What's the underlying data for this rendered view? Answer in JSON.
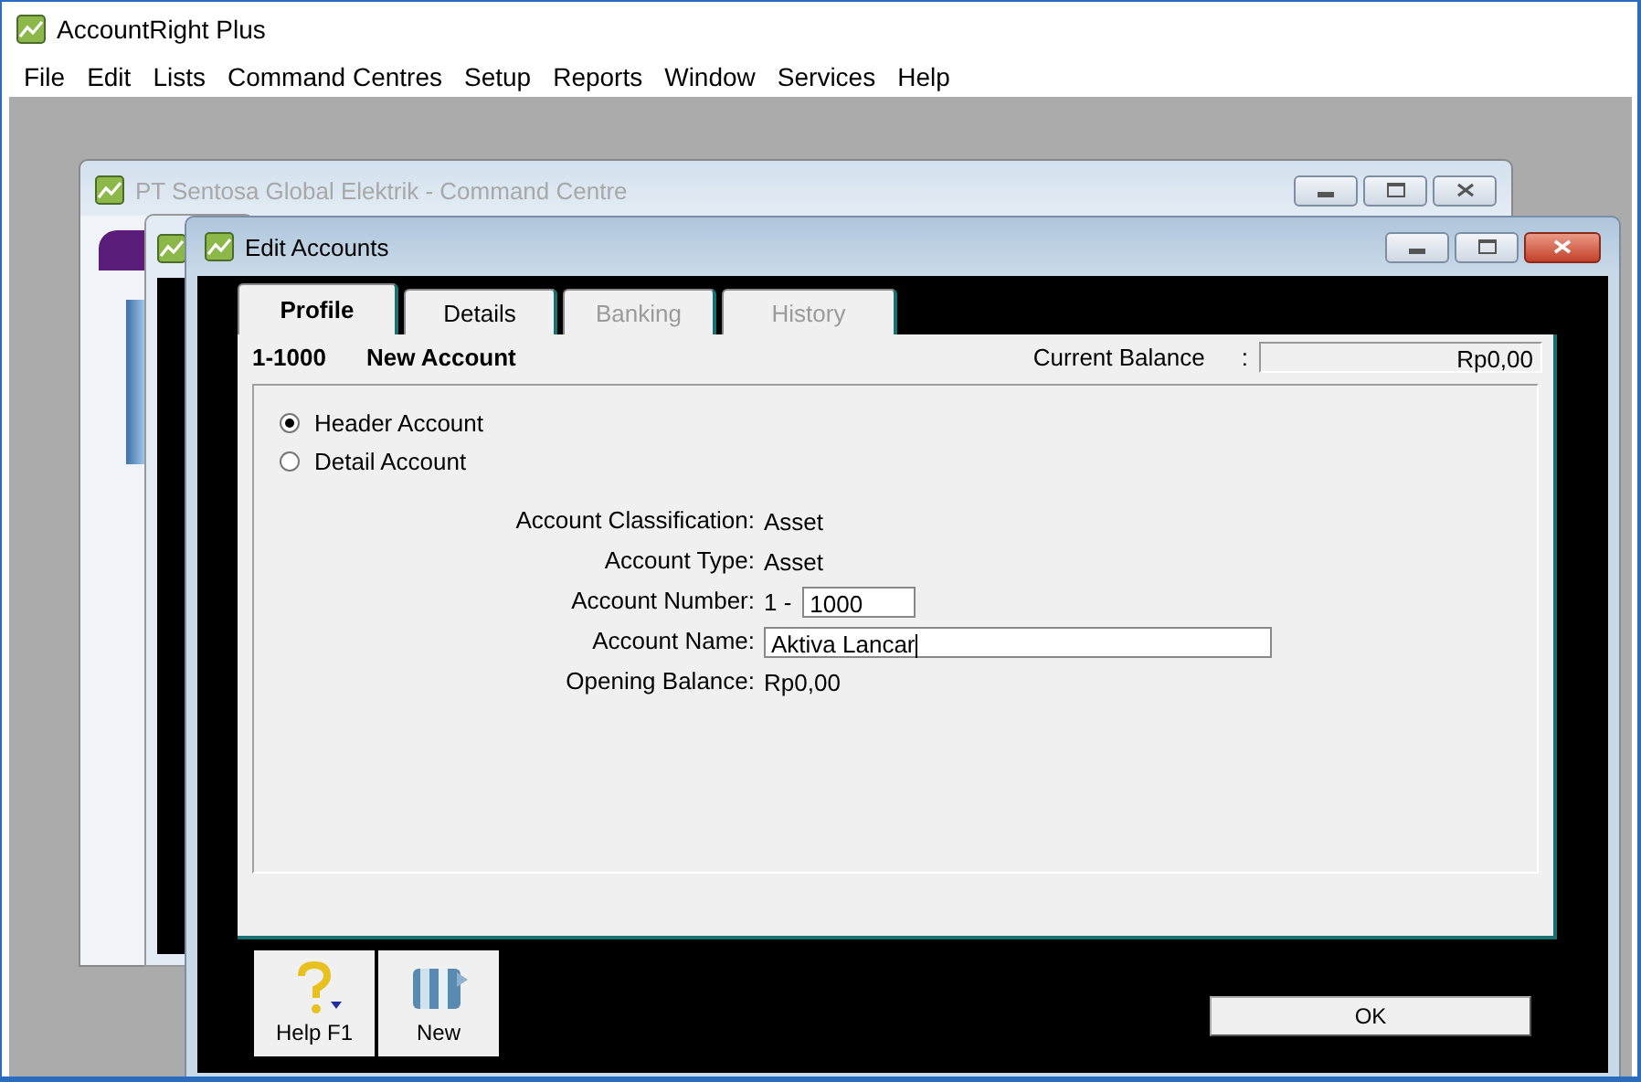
{
  "app": {
    "title": "AccountRight Plus"
  },
  "menu": [
    "File",
    "Edit",
    "Lists",
    "Command Centres",
    "Setup",
    "Reports",
    "Window",
    "Services",
    "Help"
  ],
  "back_window": {
    "title": "PT Sentosa Global Elektrik - Command Centre"
  },
  "dialog": {
    "title": "Edit Accounts",
    "tabs": [
      {
        "label": "Profile",
        "selected": true,
        "disabled": false
      },
      {
        "label": "Details",
        "selected": false,
        "disabled": false
      },
      {
        "label": "Banking",
        "selected": false,
        "disabled": true
      },
      {
        "label": "History",
        "selected": false,
        "disabled": true
      }
    ],
    "account_code": "1-1000",
    "account_title": "New Account",
    "balance_label": "Current Balance",
    "balance_separator": ":",
    "balance_value": "Rp0,00",
    "account_types": [
      {
        "label": "Header Account",
        "selected": true
      },
      {
        "label": "Detail Account",
        "selected": false
      }
    ],
    "fields": [
      {
        "kind": "text",
        "label": "Account Classification:",
        "value": "Asset"
      },
      {
        "kind": "text",
        "label": "Account Type:",
        "value": "Asset"
      },
      {
        "kind": "number",
        "label": "Account Number:",
        "prefix": "1 -",
        "value": "1000"
      },
      {
        "kind": "input",
        "label": "Account Name:",
        "value": "Aktiva Lancar"
      },
      {
        "kind": "text",
        "label": "Opening Balance:",
        "value": "Rp0,00"
      }
    ],
    "toolbar": [
      {
        "kind": "help",
        "label": "Help F1"
      },
      {
        "kind": "new",
        "label": "New"
      }
    ],
    "ok": "OK"
  }
}
